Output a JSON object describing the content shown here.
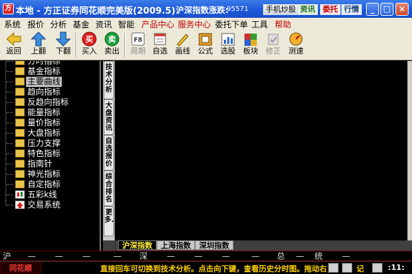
{
  "titlebar": {
    "app_icon_label": "方",
    "title": "本地  -  方正证券同花顺完美版(2009.5)",
    "index_label": "沪深指数涨跌:",
    "index_value": "95571",
    "phone_label": "手机炒股",
    "info_label": "资讯",
    "order_label": "委托",
    "quote_label": "行情"
  },
  "menu": [
    "系统",
    "报价",
    "分析",
    "基金",
    "资讯",
    "智能",
    "产品中心",
    "服务中心",
    "委托下单",
    "工具",
    "帮助"
  ],
  "toolbar": [
    {
      "label": "返回",
      "icon": "back-icon"
    },
    {
      "label": "上翻",
      "icon": "page-up-icon"
    },
    {
      "label": "下翻",
      "icon": "page-down-icon"
    },
    {
      "label": "买入",
      "icon": "buy-icon",
      "glyph": "买"
    },
    {
      "label": "卖出",
      "icon": "sell-icon",
      "glyph": "卖"
    },
    {
      "label": "周期",
      "icon": "period-icon",
      "glyph": "F8",
      "disabled": true
    },
    {
      "label": "自选",
      "icon": "favorites-icon"
    },
    {
      "label": "画线",
      "icon": "draw-line-icon"
    },
    {
      "label": "公式",
      "icon": "formula-icon"
    },
    {
      "label": "选股",
      "icon": "stock-picker-icon"
    },
    {
      "label": "板块",
      "icon": "sector-icon"
    },
    {
      "label": "修正",
      "icon": "correct-icon",
      "disabled": true
    },
    {
      "label": "测速",
      "icon": "speed-test-icon"
    }
  ],
  "tree": [
    {
      "label": "分时指标",
      "icon": "folder-icon"
    },
    {
      "label": "基金指标",
      "icon": "folder-icon"
    },
    {
      "label": "主要曲线",
      "icon": "folder-icon",
      "selected": true
    },
    {
      "label": "趋向指标",
      "icon": "folder-icon"
    },
    {
      "label": "反趋向指标",
      "icon": "folder-icon"
    },
    {
      "label": "能量指标",
      "icon": "folder-icon"
    },
    {
      "label": "量价指标",
      "icon": "folder-icon"
    },
    {
      "label": "大盘指标",
      "icon": "folder-icon"
    },
    {
      "label": "压力支撑",
      "icon": "folder-icon"
    },
    {
      "label": "特色指标",
      "icon": "folder-icon"
    },
    {
      "label": "指南针",
      "icon": "folder-icon"
    },
    {
      "label": "神光指标",
      "icon": "folder-icon"
    },
    {
      "label": "自定指标",
      "icon": "folder-icon"
    },
    {
      "label": "五彩k线",
      "icon": "candlestick-icon"
    },
    {
      "label": "交易系统",
      "icon": "trade-system-icon"
    }
  ],
  "vtabs": [
    "技术分析",
    "大盘资讯",
    "自选报价",
    "综合排名",
    "更多..."
  ],
  "market_tabs": [
    "沪深指数",
    "上海指数",
    "深圳指数"
  ],
  "index_line": {
    "sh": "沪",
    "sh_values": [
      "—",
      "—",
      "—",
      "—"
    ],
    "sz": "深",
    "sz_values": [
      "—",
      "—",
      "—",
      "—"
    ],
    "total": "总",
    "total_value": "—",
    "stat": "统",
    "stat_value": "—"
  },
  "status": {
    "brand": "同花顺",
    "ticker": "直接回车可切换到技术分析。点击向下键，查看历史分时图。拖动右",
    "note": "记",
    "time": ":11:"
  }
}
